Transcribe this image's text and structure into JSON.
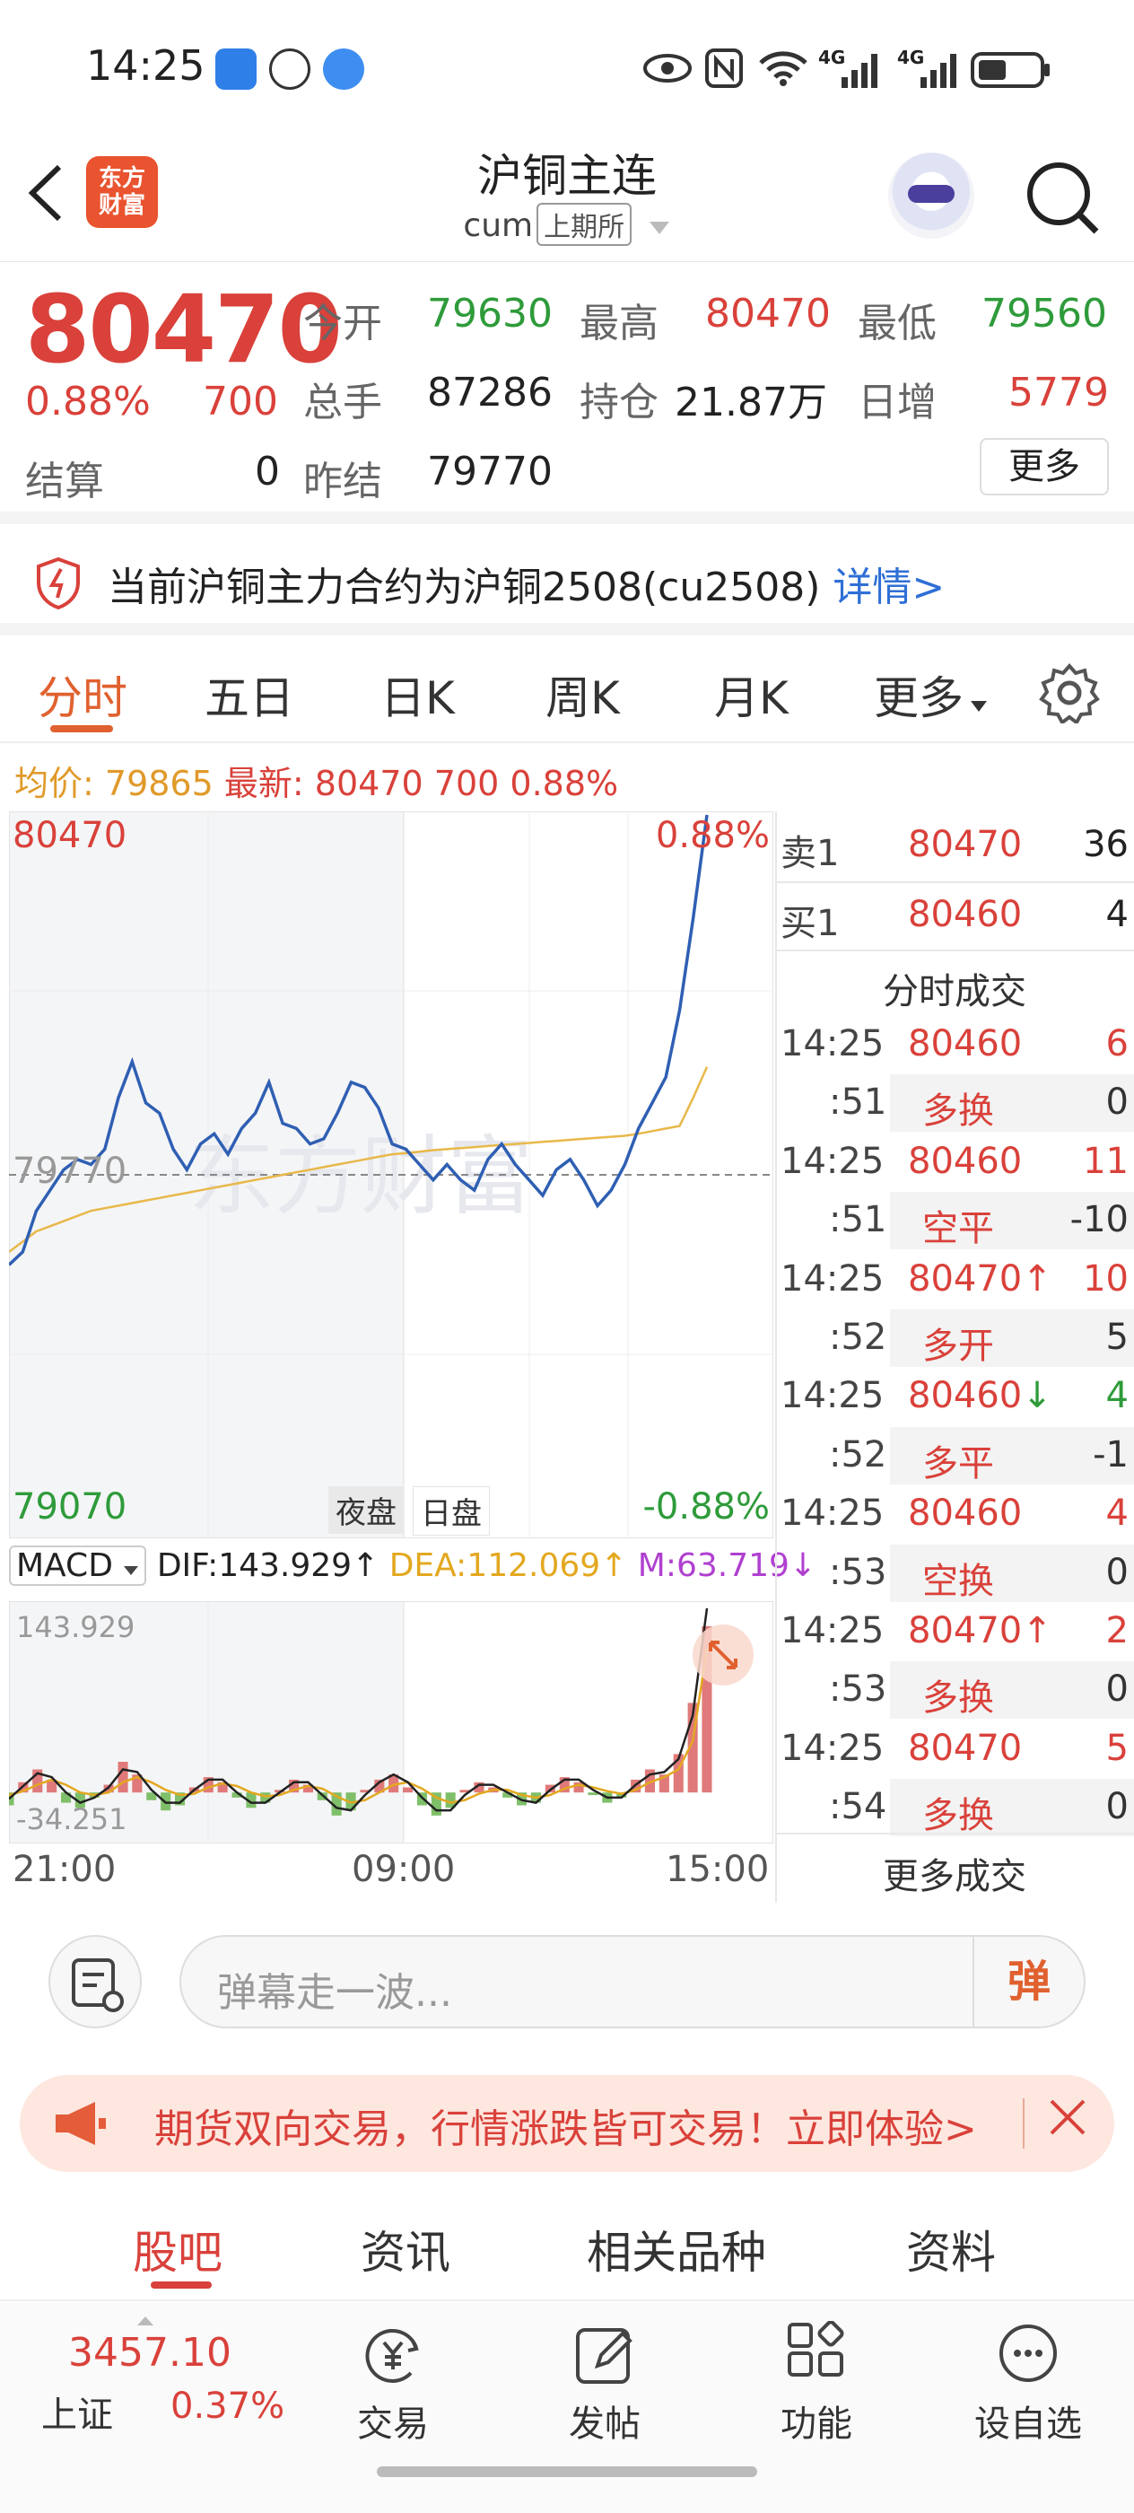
{
  "status_bar": {
    "time": "14:25",
    "net1": "4G",
    "net2": "4G"
  },
  "header": {
    "logo_line1": "东方",
    "logo_line2": "财富",
    "title": "沪铜主连",
    "code": "cum",
    "exchange": "上期所"
  },
  "quote": {
    "price": "80470",
    "change_pct": "0.88%",
    "change": "700",
    "settle_label": "结算",
    "settle": "0",
    "open_label": "今开",
    "open": "79630",
    "high_label": "最高",
    "high": "80470",
    "low_label": "最低",
    "low": "79560",
    "volume_label": "总手",
    "volume": "87286",
    "oi_label": "持仓",
    "oi": "21.87万",
    "daily_inc_label": "日增",
    "daily_inc": "5779",
    "prev_settle_label": "昨结",
    "prev_settle": "79770",
    "more_label": "更多"
  },
  "notice": {
    "text": "当前沪铜主力合约为沪铜2508(cu2508)",
    "link": "详情>"
  },
  "chart_tabs": [
    "分时",
    "五日",
    "日K",
    "周K",
    "月K",
    "更多"
  ],
  "info_line": {
    "avg_label": "均价:",
    "avg": "79865",
    "latest_label": "最新:",
    "latest": "80470",
    "change": "700",
    "pct": "0.88%"
  },
  "intraday": {
    "y_top": "80470",
    "y_top_pct": "0.88%",
    "y_mid": "79770",
    "y_bottom": "79070",
    "y_bottom_pct": "-0.88%",
    "session_night": "夜盘",
    "session_day": "日盘",
    "watermark": "东方财富"
  },
  "chart_data": {
    "type": "line",
    "title": "",
    "xlabel": "",
    "ylabel": "",
    "x_ticks": [
      "21:00",
      "09:00",
      "15:00"
    ],
    "ylim": [
      79070,
      80470
    ],
    "reference": 79770,
    "series": [
      {
        "name": "",
        "color": "#2f5fb3",
        "values": [
          79595,
          79620,
          79700,
          79740,
          79780,
          79800,
          79790,
          79820,
          79920,
          79990,
          79910,
          79890,
          79820,
          79780,
          79830,
          79850,
          79810,
          79860,
          79890,
          79950,
          79870,
          79860,
          79830,
          79840,
          79890,
          79950,
          79940,
          79900,
          79830,
          79820,
          79790,
          79760,
          79790,
          79760,
          79740,
          79800,
          79830,
          79790,
          79760,
          79730,
          79780,
          79800,
          79760,
          79710,
          79740,
          79790,
          79860,
          79910,
          79960,
          80090,
          80270,
          80470
        ]
      },
      {
        "name": "",
        "color": "#e8b84a",
        "values": [
          79620,
          79640,
          79660,
          79670,
          79680,
          79690,
          79700,
          79705,
          79710,
          79715,
          79720,
          79725,
          79730,
          79735,
          79740,
          79745,
          79750,
          79755,
          79760,
          79765,
          79770,
          79775,
          79780,
          79785,
          79790,
          79795,
          79800,
          79805,
          79810,
          79812,
          79815,
          79818,
          79820,
          79822,
          79824,
          79826,
          79828,
          79830,
          79832,
          79834,
          79836,
          79838,
          79840,
          79842,
          79844,
          79846,
          79850,
          79855,
          79860,
          79865,
          79920,
          79980
        ]
      }
    ]
  },
  "macd": {
    "selector": "MACD",
    "dif": "DIF:143.929↑",
    "dea": "DEA:112.069↑",
    "m": "M:63.719↓",
    "top": "143.929",
    "bottom": "-34.251",
    "chart_data": {
      "type": "bar",
      "ylim": [
        -34.251,
        143.929
      ],
      "hist": [
        -10,
        8,
        18,
        10,
        -8,
        -12,
        -4,
        6,
        24,
        14,
        -6,
        -14,
        -10,
        4,
        12,
        8,
        -4,
        -12,
        -8,
        2,
        10,
        6,
        -6,
        -18,
        -14,
        2,
        10,
        14,
        4,
        -10,
        -18,
        -12,
        2,
        8,
        4,
        -4,
        -10,
        -8,
        6,
        12,
        8,
        -2,
        -8,
        -4,
        10,
        18,
        14,
        30,
        70,
        130
      ],
      "dif": [
        -5,
        5,
        15,
        12,
        0,
        -8,
        -4,
        4,
        18,
        16,
        2,
        -8,
        -8,
        2,
        10,
        10,
        0,
        -8,
        -8,
        0,
        8,
        8,
        -2,
        -12,
        -14,
        -2,
        8,
        14,
        8,
        -4,
        -14,
        -14,
        -2,
        6,
        6,
        0,
        -6,
        -8,
        2,
        10,
        10,
        2,
        -4,
        -4,
        6,
        14,
        16,
        26,
        60,
        143.929
      ],
      "dea": [
        -2,
        1,
        6,
        10,
        6,
        0,
        -2,
        0,
        8,
        12,
        8,
        2,
        -2,
        -1,
        4,
        7,
        5,
        0,
        -3,
        -2,
        2,
        5,
        3,
        -3,
        -8,
        -6,
        0,
        6,
        8,
        3,
        -4,
        -8,
        -6,
        -1,
        2,
        2,
        -2,
        -4,
        -2,
        3,
        6,
        4,
        1,
        -1,
        2,
        8,
        12,
        18,
        40,
        112.069
      ]
    },
    "x_ticks": [
      "21:00",
      "09:00",
      "15:00"
    ]
  },
  "order_book": {
    "sell_label": "卖1",
    "sell_price": "80470",
    "sell_vol": "36",
    "buy_label": "买1",
    "buy_price": "80460",
    "buy_vol": "4"
  },
  "ticks": {
    "title": "分时成交",
    "rows": [
      {
        "t1": "14:25",
        "price": "80460",
        "arrow": "",
        "vol": "6",
        "t2": ":51",
        "type": "多换",
        "chg": "0",
        "type_color": "red"
      },
      {
        "t1": "14:25",
        "price": "80460",
        "arrow": "",
        "vol": "11",
        "t2": ":51",
        "type": "空平",
        "chg": "-10",
        "type_color": "red"
      },
      {
        "t1": "14:25",
        "price": "80470",
        "arrow": "↑",
        "vol": "10",
        "t2": ":52",
        "type": "多开",
        "chg": "5",
        "type_color": "red"
      },
      {
        "t1": "14:25",
        "price": "80460",
        "arrow": "↓",
        "vol": "4",
        "t2": ":52",
        "type": "多平",
        "chg": "-1",
        "type_color": "green"
      },
      {
        "t1": "14:25",
        "price": "80460",
        "arrow": "",
        "vol": "4",
        "t2": ":53",
        "type": "空换",
        "chg": "0",
        "type_color": "green"
      },
      {
        "t1": "14:25",
        "price": "80470",
        "arrow": "↑",
        "vol": "2",
        "t2": ":53",
        "type": "多换",
        "chg": "0",
        "type_color": "red"
      },
      {
        "t1": "14:25",
        "price": "80470",
        "arrow": "",
        "vol": "5",
        "t2": ":54",
        "type": "多换",
        "chg": "0",
        "type_color": "red"
      }
    ],
    "more": "更多成交"
  },
  "danmu": {
    "placeholder": "弹幕走一波...",
    "button": "弹"
  },
  "ad": {
    "text": "期货双向交易，行情涨跌皆可交易！立即体验>"
  },
  "bottom_tabs": [
    "股吧",
    "资讯",
    "相关品种",
    "资料"
  ],
  "bottom_nav": {
    "index_value": "3457.10",
    "index_name": "上证",
    "index_pct": "0.37%",
    "items": [
      {
        "label": "交易",
        "icon": "trade-icon"
      },
      {
        "label": "发帖",
        "icon": "post-icon"
      },
      {
        "label": "功能",
        "icon": "apps-icon"
      },
      {
        "label": "设自选",
        "icon": "favorite-icon"
      }
    ]
  }
}
